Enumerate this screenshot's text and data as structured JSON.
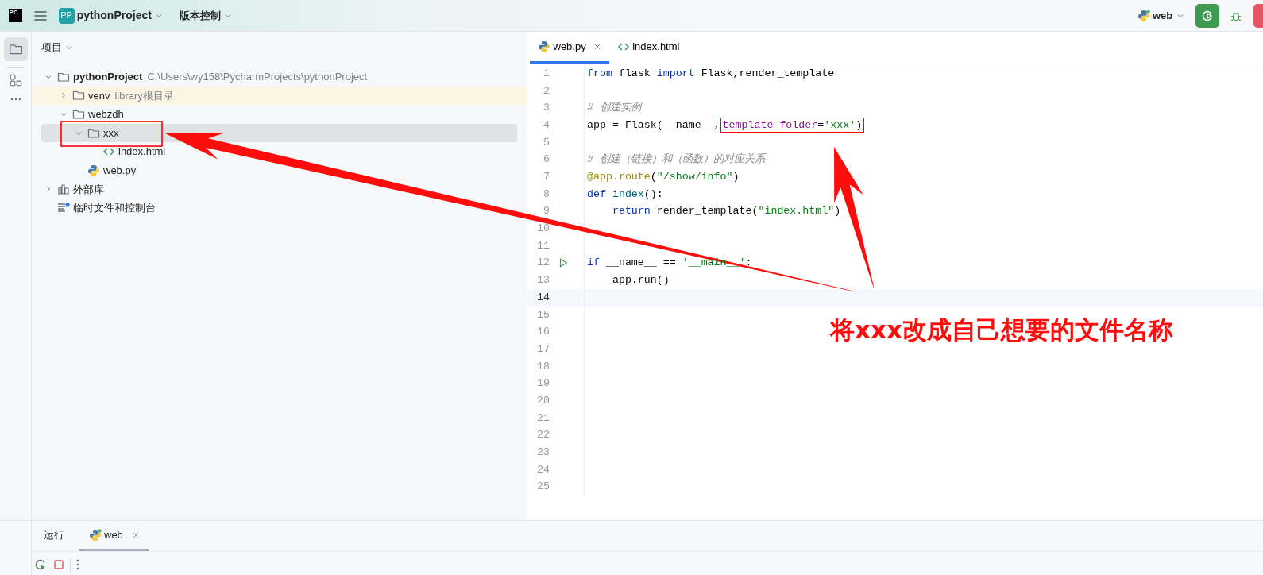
{
  "toolbar": {
    "logo": "PC",
    "project_badge": "PP",
    "project": "pythonProject",
    "vcs": "版本控制",
    "run_config": "web"
  },
  "project_panel": {
    "title": "项目",
    "tree": [
      {
        "name": "pythonProject",
        "detail": "C:\\Users\\wy158\\PycharmProjects\\pythonProject",
        "kind": "folder",
        "expanded": true,
        "selected": false,
        "children": [
          {
            "name": "venv",
            "detail": "library根目录",
            "kind": "library",
            "expanded": false,
            "selected": false
          },
          {
            "name": "webzdh",
            "kind": "folder",
            "expanded": true,
            "selected": false,
            "children": [
              {
                "name": "xxx",
                "kind": "folder",
                "expanded": true,
                "selected": true,
                "children": [
                  {
                    "name": "index.html",
                    "kind": "html",
                    "selected": false
                  }
                ]
              },
              {
                "name": "web.py",
                "kind": "python",
                "selected": false
              }
            ]
          }
        ]
      },
      {
        "name": "外部库",
        "kind": "external",
        "expanded": false,
        "selected": false
      },
      {
        "name": "临时文件和控制台",
        "kind": "scratch",
        "selected": false
      }
    ]
  },
  "editor": {
    "tabs": [
      {
        "label": "web.py",
        "kind": "python",
        "selected": true,
        "closable": true
      },
      {
        "label": "index.html",
        "kind": "html",
        "selected": false,
        "closable": false
      }
    ],
    "lines": [
      {
        "number": "1",
        "current": false,
        "runnable": false,
        "tokens": [
          {
            "t": "from",
            "kind": "kw"
          },
          {
            "t": " flask ",
            "kind": "plain"
          },
          {
            "t": "import",
            "kind": "kw"
          },
          {
            "t": " Flask,render_template",
            "kind": "plain"
          }
        ]
      },
      {
        "number": "2",
        "current": false,
        "runnable": false
      },
      {
        "number": "3",
        "current": false,
        "runnable": false,
        "tokens": [
          {
            "t": "# 创建实例",
            "kind": "comment"
          }
        ]
      },
      {
        "number": "4",
        "current": false,
        "runnable": false,
        "tokens": [
          {
            "t": "app = Flask(__name__,",
            "kind": "plain",
            "boxed": false
          },
          {
            "t": "template_folder",
            "kind": "param",
            "boxed": true
          },
          {
            "t": "=",
            "kind": "plain",
            "boxed": true
          },
          {
            "t": "'xxx'",
            "kind": "string",
            "boxed": true
          },
          {
            "t": ")",
            "kind": "plain",
            "boxed": true
          }
        ]
      },
      {
        "number": "5",
        "current": false,
        "runnable": false
      },
      {
        "number": "6",
        "current": false,
        "runnable": false,
        "tokens": [
          {
            "t": "# 创建（链接）和（函数）的对应关系",
            "kind": "comment"
          }
        ]
      },
      {
        "number": "7",
        "current": false,
        "runnable": false,
        "tokens": [
          {
            "t": "@app.route",
            "kind": "decorator"
          },
          {
            "t": "(",
            "kind": "plain"
          },
          {
            "t": "\"/show/info\"",
            "kind": "string"
          },
          {
            "t": ")",
            "kind": "plain"
          }
        ]
      },
      {
        "number": "8",
        "current": false,
        "runnable": false,
        "tokens": [
          {
            "t": "def ",
            "kind": "kw"
          },
          {
            "t": "index",
            "kind": "fn"
          },
          {
            "t": "():",
            "kind": "plain"
          }
        ]
      },
      {
        "number": "9",
        "current": false,
        "runnable": false,
        "tokens": [
          {
            "t": "    return",
            "kind": "kw"
          },
          {
            "t": " render_template(",
            "kind": "plain"
          },
          {
            "t": "\"index.html\"",
            "kind": "string"
          },
          {
            "t": ")",
            "kind": "plain"
          }
        ]
      },
      {
        "number": "10",
        "current": false,
        "runnable": false
      },
      {
        "number": "11",
        "current": false,
        "runnable": false
      },
      {
        "number": "12",
        "current": false,
        "runnable": true,
        "tokens": [
          {
            "t": "if",
            "kind": "kw"
          },
          {
            "t": " __name__ == ",
            "kind": "plain"
          },
          {
            "t": "'__main__'",
            "kind": "string"
          },
          {
            "t": ":",
            "kind": "plain"
          }
        ]
      },
      {
        "number": "13",
        "current": false,
        "runnable": false,
        "tokens": [
          {
            "t": "    app.run()",
            "kind": "plain"
          }
        ]
      },
      {
        "number": "14",
        "current": true,
        "runnable": false
      },
      {
        "number": "15",
        "current": false,
        "runnable": false
      },
      {
        "number": "16",
        "current": false,
        "runnable": false
      },
      {
        "number": "17",
        "current": false,
        "runnable": false
      },
      {
        "number": "18",
        "current": false,
        "runnable": false
      },
      {
        "number": "19",
        "current": false,
        "runnable": false
      },
      {
        "number": "20",
        "current": false,
        "runnable": false
      },
      {
        "number": "21",
        "current": false,
        "runnable": false
      },
      {
        "number": "22",
        "current": false,
        "runnable": false
      },
      {
        "number": "23",
        "current": false,
        "runnable": false
      },
      {
        "number": "24",
        "current": false,
        "runnable": false
      },
      {
        "number": "25",
        "current": false,
        "runnable": false
      }
    ]
  },
  "bottom_panel": {
    "tabs": [
      {
        "label": "运行",
        "kind": "plain",
        "selected": false,
        "closable": false
      },
      {
        "label": "web",
        "kind": "python",
        "selected": true,
        "closable": true
      }
    ]
  },
  "annotation": {
    "text": "将xxx改成自己想要的文件名称"
  }
}
